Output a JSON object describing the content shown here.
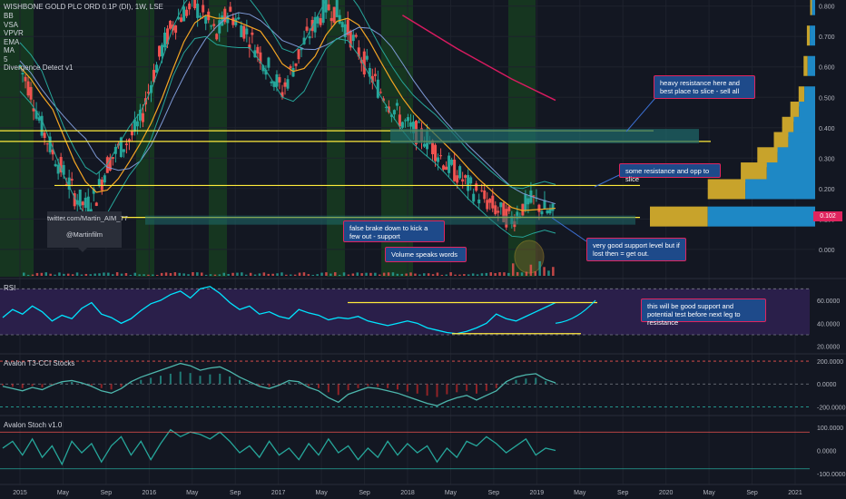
{
  "header": {
    "symbol": "WISHBONE GOLD PLC ORD 0.1P (DI), 1W, LSE",
    "indicators": [
      "BB",
      "VSA",
      "VPVR",
      "EMA",
      "MA",
      "5",
      "Divergence Detect v1"
    ]
  },
  "watermark": {
    "line1": "twitter.com/Martin_AIM_77",
    "line2": "@Martinfilm"
  },
  "price_badge": "0.102",
  "annotations": {
    "heavy_resistance": "heavy resistance here and best place to slice - sell all",
    "some_resistance": "some resistance and opp to slice",
    "false_break": "false brake down to kick a few out - support",
    "volume": "Volume speaks words",
    "support_level": "very good support level but if lost then = get out.",
    "rsi_note": "this will be good support and potential test before next leg to resistance"
  },
  "panes": {
    "rsi": "RSI",
    "t3cci": "Avalon T3-CCI Stocks",
    "stoch": "Avalon Stoch v1.0"
  },
  "colors": {
    "background": "#131722",
    "up_candle": "#26a69a",
    "down_candle": "#ef5350",
    "resistance": "#ffeb3b",
    "callout": "#1e4a8a",
    "callout_border": "#e0245e",
    "rsi_line": "#00e5ff",
    "rsi_band": "#2a1f4a",
    "price_badge": "#e0245e"
  },
  "chart_data": [
    {
      "type": "candlestick",
      "title": "WISHBONE GOLD PLC ORD 0.1P (DI), 1W, LSE",
      "x_ticks": [
        "2015",
        "May",
        "Sep",
        "2016",
        "May",
        "Sep",
        "2017",
        "May",
        "Sep",
        "2018",
        "May",
        "Sep",
        "2019",
        "May",
        "Sep",
        "2020",
        "May",
        "Sep",
        "2021"
      ],
      "y_ticks": [
        "0.800",
        "0.700",
        "0.600",
        "0.500",
        "0.400",
        "0.300",
        "0.200",
        "0.100",
        "0.000"
      ],
      "ylim": [
        -0.09,
        0.82
      ],
      "close_path": [
        {
          "t": 0.0,
          "v": 0.6
        },
        {
          "t": 0.05,
          "v": 0.52
        },
        {
          "t": 0.1,
          "v": 0.4
        },
        {
          "t": 0.15,
          "v": 0.32
        },
        {
          "t": 0.2,
          "v": 0.25
        },
        {
          "t": 0.25,
          "v": 0.18
        },
        {
          "t": 0.3,
          "v": 0.14
        },
        {
          "t": 0.35,
          "v": 0.18
        },
        {
          "t": 0.4,
          "v": 0.28
        },
        {
          "t": 0.45,
          "v": 0.33
        },
        {
          "t": 0.5,
          "v": 0.36
        },
        {
          "t": 0.55,
          "v": 0.42
        },
        {
          "t": 0.6,
          "v": 0.55
        },
        {
          "t": 0.65,
          "v": 0.66
        },
        {
          "t": 0.7,
          "v": 0.74
        },
        {
          "t": 0.75,
          "v": 0.78
        },
        {
          "t": 0.8,
          "v": 0.8
        },
        {
          "t": 0.85,
          "v": 0.76
        },
        {
          "t": 0.9,
          "v": 0.7
        },
        {
          "t": 0.95,
          "v": 0.78
        },
        {
          "t": 1.0,
          "v": 0.75
        },
        {
          "t": 1.05,
          "v": 0.7
        },
        {
          "t": 1.1,
          "v": 0.64
        },
        {
          "t": 1.15,
          "v": 0.58
        },
        {
          "t": 1.2,
          "v": 0.52
        },
        {
          "t": 1.25,
          "v": 0.6
        },
        {
          "t": 1.3,
          "v": 0.68
        },
        {
          "t": 1.35,
          "v": 0.74
        },
        {
          "t": 1.4,
          "v": 0.8
        },
        {
          "t": 1.45,
          "v": 0.78
        },
        {
          "t": 1.5,
          "v": 0.72
        },
        {
          "t": 1.55,
          "v": 0.65
        },
        {
          "t": 1.6,
          "v": 0.58
        },
        {
          "t": 1.65,
          "v": 0.52
        },
        {
          "t": 1.7,
          "v": 0.47
        },
        {
          "t": 1.75,
          "v": 0.42
        },
        {
          "t": 1.8,
          "v": 0.39
        },
        {
          "t": 1.85,
          "v": 0.37
        },
        {
          "t": 1.9,
          "v": 0.33
        },
        {
          "t": 1.95,
          "v": 0.28
        },
        {
          "t": 2.0,
          "v": 0.25
        },
        {
          "t": 2.05,
          "v": 0.21
        },
        {
          "t": 2.1,
          "v": 0.18
        },
        {
          "t": 2.15,
          "v": 0.15
        },
        {
          "t": 2.2,
          "v": 0.12
        },
        {
          "t": 2.25,
          "v": 0.1
        },
        {
          "t": 2.3,
          "v": 0.14
        },
        {
          "t": 2.35,
          "v": 0.16
        },
        {
          "t": 2.4,
          "v": 0.13
        },
        {
          "t": 2.45,
          "v": 0.11
        }
      ],
      "resistance_levels": [
        0.39,
        0.355,
        0.21,
        0.105
      ],
      "volume_profile": [
        {
          "level": 0.8,
          "size": 0.03
        },
        {
          "level": 0.7,
          "size": 0.05
        },
        {
          "level": 0.6,
          "size": 0.07
        },
        {
          "level": 0.5,
          "size": 0.1
        },
        {
          "level": 0.45,
          "size": 0.15
        },
        {
          "level": 0.4,
          "size": 0.2
        },
        {
          "level": 0.35,
          "size": 0.25
        },
        {
          "level": 0.3,
          "size": 0.35
        },
        {
          "level": 0.25,
          "size": 0.45
        },
        {
          "level": 0.195,
          "size": 0.65
        },
        {
          "level": 0.105,
          "size": 1.0
        }
      ]
    },
    {
      "type": "line",
      "title": "RSI",
      "y_ticks": [
        "60.0000",
        "40.0000",
        "20.0000"
      ],
      "ylim": [
        15,
        75
      ],
      "bands": [
        70,
        30
      ],
      "values": [
        45,
        52,
        48,
        55,
        50,
        42,
        47,
        44,
        53,
        58,
        48,
        45,
        40,
        44,
        51,
        57,
        60,
        65,
        68,
        62,
        70,
        72,
        66,
        58,
        52,
        55,
        48,
        50,
        46,
        44,
        52,
        49,
        47,
        43,
        45,
        44,
        46,
        42,
        40,
        38,
        40,
        42,
        40,
        36,
        34,
        32,
        31,
        33,
        36,
        40,
        48,
        44,
        42,
        46,
        50,
        54,
        58
      ]
    },
    {
      "type": "line",
      "title": "Avalon T3-CCI Stocks",
      "y_ticks": [
        "200.0000",
        "0.0000",
        "-200.0000"
      ],
      "ylim": [
        -260,
        240
      ],
      "values": [
        -20,
        -40,
        -60,
        -30,
        -50,
        -10,
        20,
        30,
        10,
        -20,
        -60,
        -80,
        -40,
        20,
        60,
        90,
        120,
        150,
        180,
        160,
        120,
        140,
        150,
        110,
        60,
        20,
        -20,
        -40,
        -10,
        30,
        20,
        -30,
        -60,
        -120,
        -160,
        -90,
        -60,
        -30,
        -40,
        -60,
        -80,
        -110,
        -140,
        -170,
        -190,
        -150,
        -120,
        -100,
        -140,
        -100,
        -60,
        20,
        60,
        80,
        90,
        40,
        10
      ]
    },
    {
      "type": "line",
      "title": "Avalon Stoch v1.0",
      "y_ticks": [
        "100.0000",
        "0.0000",
        "-100.0000"
      ],
      "ylim": [
        -140,
        140
      ],
      "values": [
        10,
        40,
        -20,
        50,
        -30,
        20,
        -60,
        40,
        -10,
        30,
        -50,
        20,
        60,
        -20,
        40,
        -40,
        30,
        90,
        60,
        80,
        70,
        50,
        80,
        40,
        -10,
        20,
        -30,
        40,
        -20,
        10,
        -40,
        30,
        -20,
        50,
        -10,
        20,
        -40,
        10,
        -30,
        40,
        -20,
        30,
        -10,
        20,
        -50,
        10,
        -30,
        40,
        20,
        60,
        30,
        -10,
        20,
        50,
        -20,
        10,
        0
      ]
    }
  ]
}
